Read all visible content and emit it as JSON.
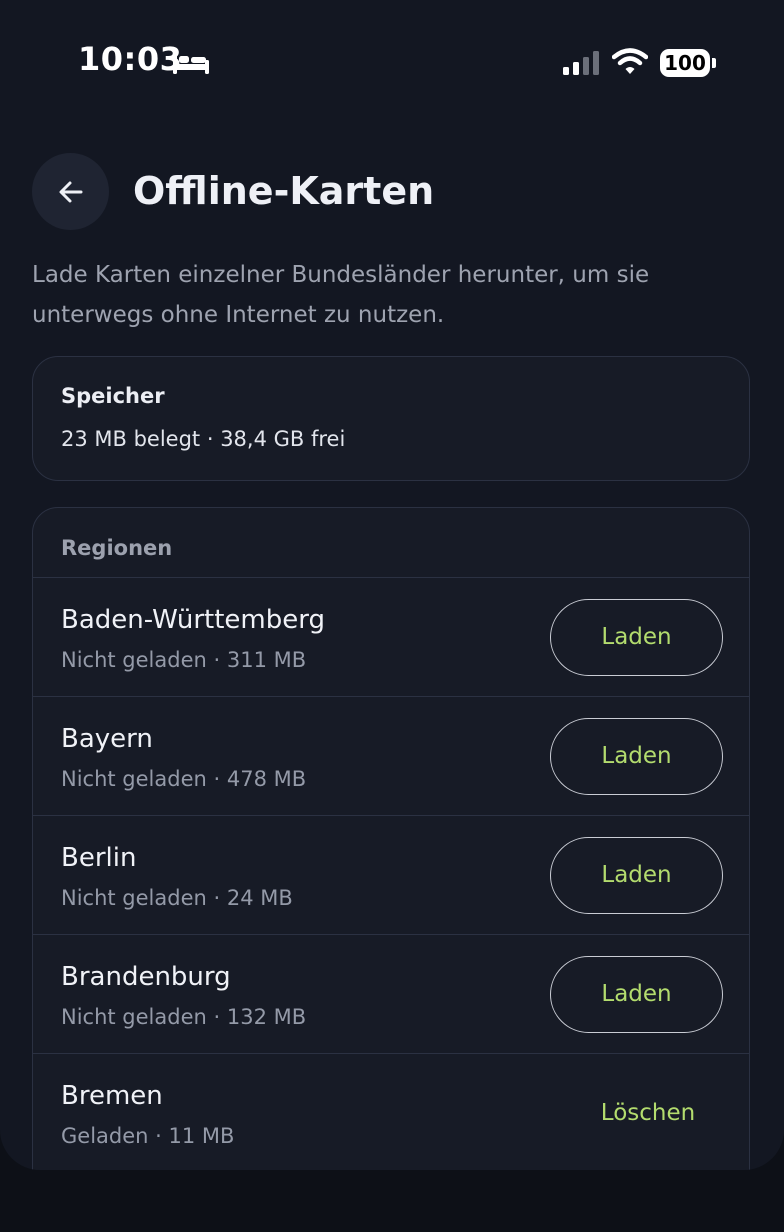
{
  "status_bar": {
    "time": "10:03",
    "battery": "100"
  },
  "header": {
    "title": "Offline-Karten",
    "description": "Lade Karten einzelner Bundesländer herunter, um sie unterwegs ohne Internet zu nutzen."
  },
  "storage": {
    "label": "Speicher",
    "value": "23 MB belegt · 38,4 GB frei"
  },
  "regions": {
    "header": "Regionen",
    "items": [
      {
        "name": "Baden-Württemberg",
        "meta": "Nicht geladen · 311 MB",
        "action": "Laden"
      },
      {
        "name": "Bayern",
        "meta": "Nicht geladen · 478 MB",
        "action": "Laden"
      },
      {
        "name": "Berlin",
        "meta": "Nicht geladen · 24 MB",
        "action": "Laden"
      },
      {
        "name": "Brandenburg",
        "meta": "Nicht geladen · 132 MB",
        "action": "Laden"
      },
      {
        "name": "Bremen",
        "meta": "Geladen · 11 MB",
        "action": "Löschen"
      }
    ]
  },
  "colors": {
    "background": "#131722",
    "card": "#171b26",
    "accent": "#b3dc6e",
    "border": "#2b3142"
  },
  "icons": {
    "back": "arrow-left-icon",
    "status": [
      "bed-icon",
      "signal-icon",
      "wifi-icon",
      "battery-icon"
    ]
  }
}
